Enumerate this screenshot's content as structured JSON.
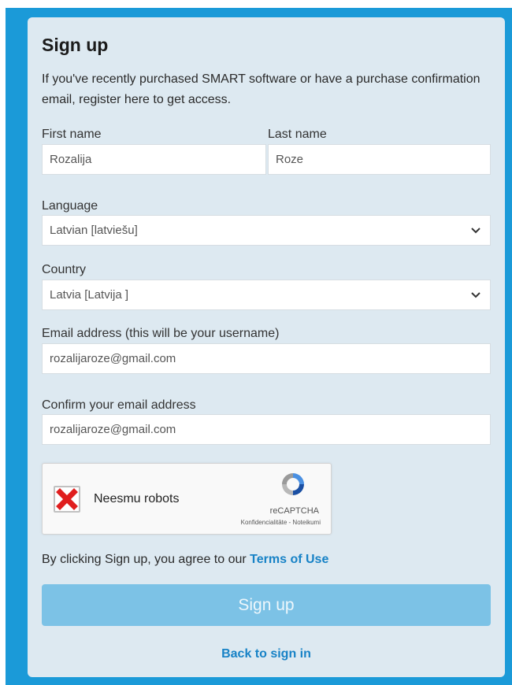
{
  "form": {
    "title": "Sign up",
    "intro": "If you've recently purchased SMART software or have a purchase confirmation email, register here to get access.",
    "first_name": {
      "label": "First name",
      "value": "Rozalija"
    },
    "last_name": {
      "label": "Last name",
      "value": "Roze"
    },
    "language": {
      "label": "Language",
      "value": "Latvian [latviešu]"
    },
    "country": {
      "label": "Country",
      "value": "Latvia [Latvija ]"
    },
    "email": {
      "label": "Email address (this will be your username)",
      "value": "rozalijaroze@gmail.com"
    },
    "confirm_email": {
      "label": "Confirm your email address",
      "value": "rozalijaroze@gmail.com"
    },
    "captcha": {
      "label": "Neesmu robots",
      "brand": "reCAPTCHA",
      "links": "Konfidencialitāte - Noteikumi",
      "status_icon": "red-x-icon"
    },
    "agree_prefix": "By clicking Sign up, you agree to our ",
    "terms_link": "Terms of Use",
    "submit_label": "Sign up",
    "back_link": "Back to sign in"
  },
  "colors": {
    "page_bg": "#1b9ad8",
    "card_bg": "#dde9f1",
    "link": "#1782c6",
    "button_disabled": "#7cc2e6"
  }
}
